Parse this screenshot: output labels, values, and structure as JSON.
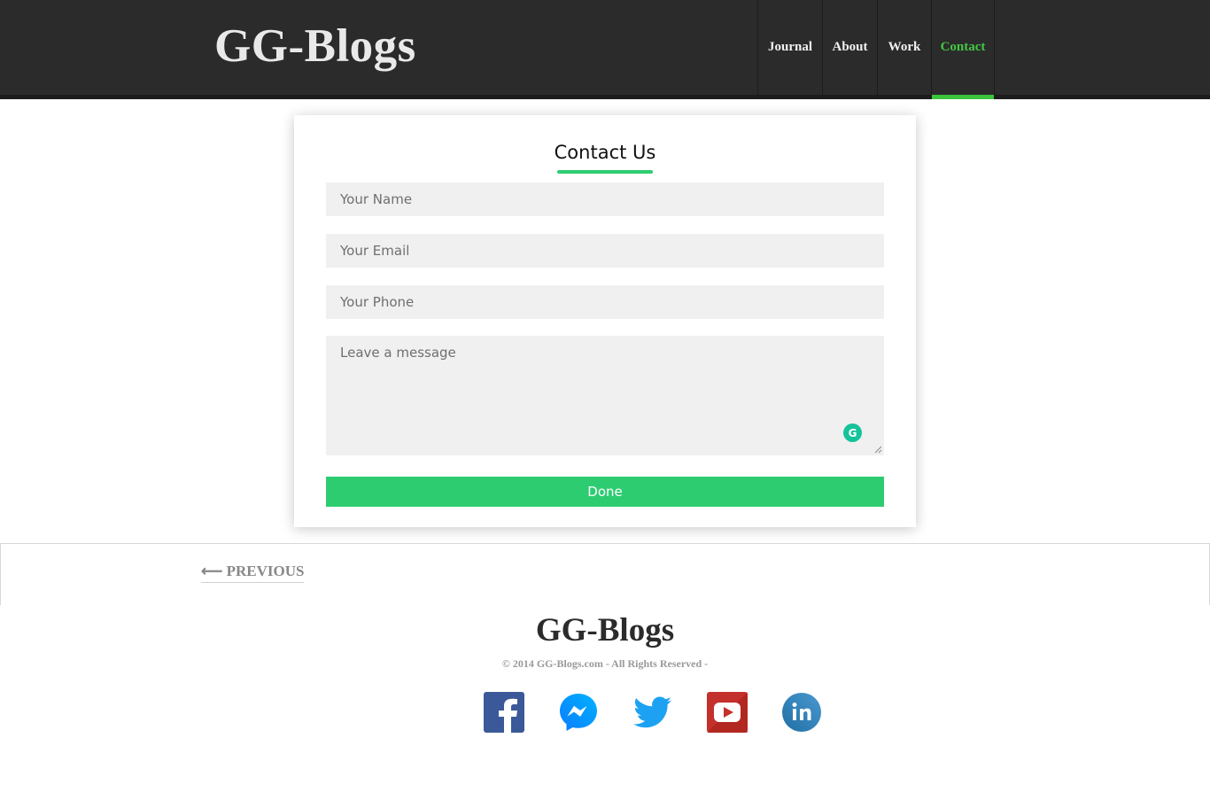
{
  "header": {
    "brand": "GG-Blogs",
    "nav": [
      {
        "label": "Journal",
        "active": false
      },
      {
        "label": "About",
        "active": false
      },
      {
        "label": "Work",
        "active": false
      },
      {
        "label": "Contact",
        "active": true
      }
    ]
  },
  "contact_form": {
    "title": "Contact Us",
    "name_placeholder": "Your Name",
    "email_placeholder": "Your Email",
    "phone_placeholder": "Your Phone",
    "message_placeholder": "Leave a message",
    "submit_label": "Done",
    "grammarly_glyph": "G"
  },
  "pager": {
    "previous_label": "⟵ PREVIOUS"
  },
  "footer": {
    "brand": "GG-Blogs",
    "copyright": "© 2014 GG-Blogs.com - All Rights Reserved -",
    "social": [
      "facebook-icon",
      "messenger-icon",
      "twitter-icon",
      "youtube-icon",
      "linkedin-icon"
    ]
  },
  "colors": {
    "header_bg": "#2b2b2b",
    "active_nav": "#43c743",
    "accent_green": "#2ecc71",
    "field_bg": "#f0f0f0"
  }
}
